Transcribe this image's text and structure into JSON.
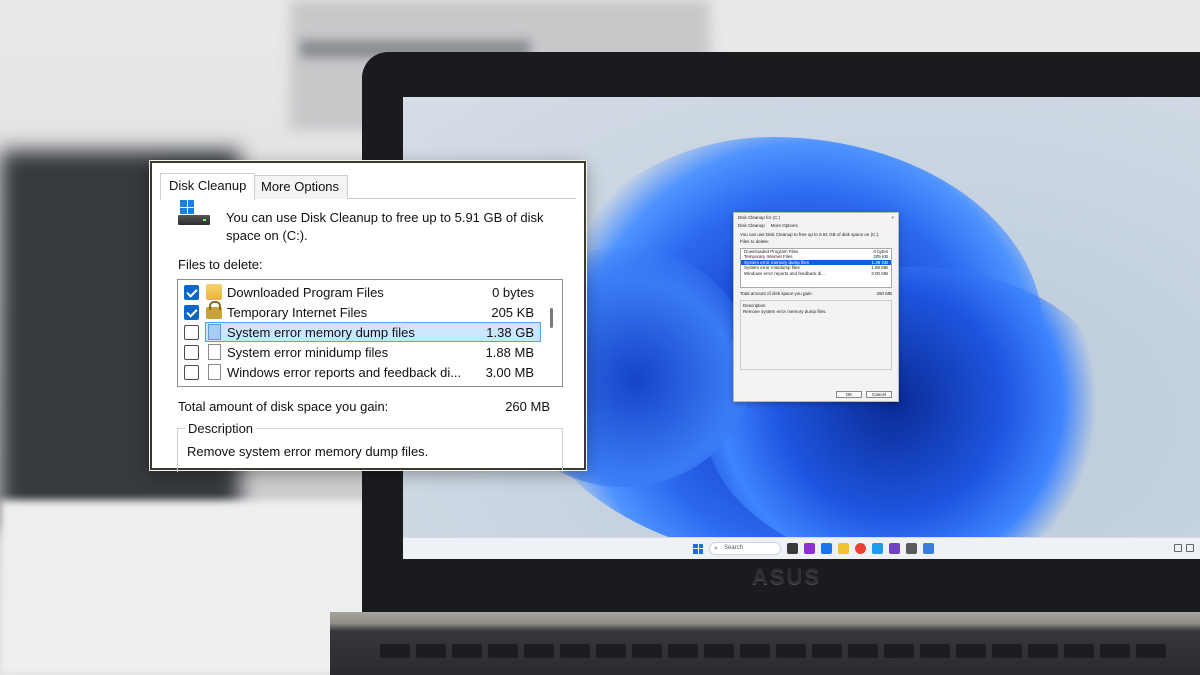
{
  "dialog": {
    "tabs": [
      {
        "label": "Disk Cleanup",
        "active": true
      },
      {
        "label": "More Options",
        "active": false
      }
    ],
    "intro": "You can use Disk Cleanup to free up to 5.91 GB of disk space on  (C:).",
    "files_label": "Files to delete:",
    "files": [
      {
        "name": "Downloaded Program Files",
        "size": "0 bytes",
        "checked": true,
        "icon": "folder-icon"
      },
      {
        "name": "Temporary Internet Files",
        "size": "205 KB",
        "checked": true,
        "icon": "lock-icon"
      },
      {
        "name": "System error memory dump files",
        "size": "1.38 GB",
        "checked": false,
        "selected": true,
        "icon": "document-icon"
      },
      {
        "name": "System error minidump files",
        "size": "1.88 MB",
        "checked": false,
        "icon": "document-icon"
      },
      {
        "name": "Windows error reports and feedback di...",
        "size": "3.00 MB",
        "checked": false,
        "icon": "document-icon"
      }
    ],
    "total_label": "Total amount of disk space you gain:",
    "total_value": "260 MB",
    "description_title": "Description",
    "description_text": "Remove system error memory dump files."
  },
  "laptop": {
    "brand": "ASUS",
    "taskbar_search": "Search",
    "mini_dialog": {
      "title": "Disk Cleanup for  (C:)",
      "close": "×",
      "tabs": [
        "Disk Cleanup",
        "More Options"
      ],
      "intro": "You can use Disk Cleanup to free up to 5.91 GB of disk space on  (C:).",
      "files_label": "Files to delete:",
      "files": [
        {
          "name": "Downloaded Program Files",
          "size": "0 bytes"
        },
        {
          "name": "Temporary Internet Files",
          "size": "205 KB"
        },
        {
          "name": "System error memory dump files",
          "size": "1.38 GB"
        },
        {
          "name": "System error minidump files",
          "size": "1.88 MB"
        },
        {
          "name": "Windows error reports and feedback di...",
          "size": "3.00 MB"
        }
      ],
      "total_label": "Total amount of disk space you gain:",
      "total_value": "260 MB",
      "description_title": "Description",
      "description_text": "Remove system error memory dump files.",
      "ok": "OK",
      "cancel": "Cancel"
    }
  },
  "colors": {
    "selection": "#cde6ff",
    "checkbox_on": "#0a67c7",
    "wallpaper_blue": "#1747cf"
  }
}
